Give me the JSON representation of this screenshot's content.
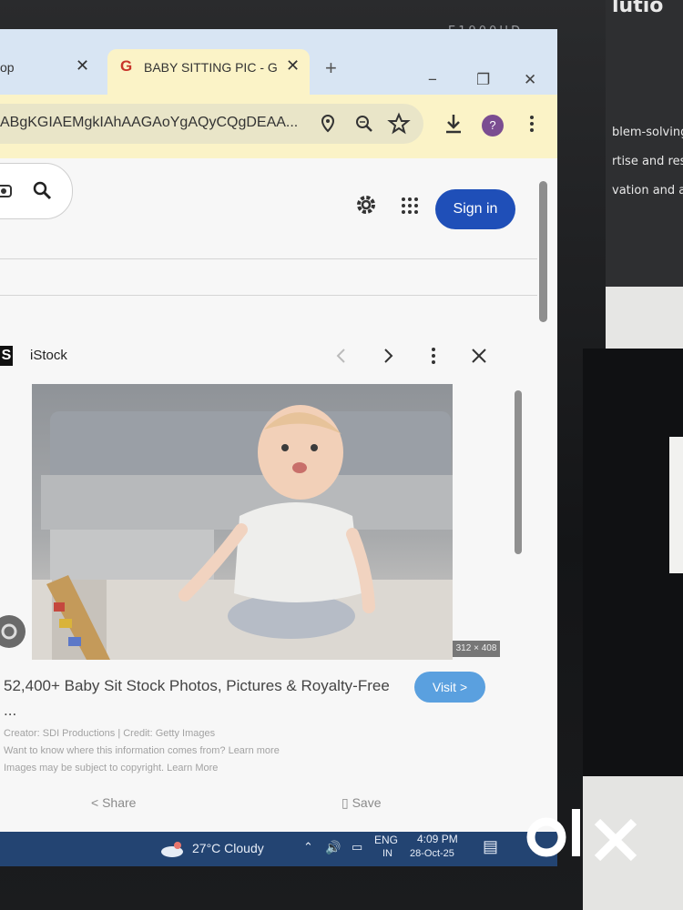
{
  "monitor": {
    "brand": "E1900HD"
  },
  "side_panel": {
    "lines": [
      "lutio",
      "blem-solving",
      "rtise and res",
      "vation and ac"
    ]
  },
  "watermark": {
    "text": "olx"
  },
  "browser": {
    "tabs": [
      {
        "label": "op",
        "close": "✕"
      },
      {
        "label": "BABY SITTING PIC - G",
        "close": "✕",
        "favicon": "G"
      }
    ],
    "new_tab": "+",
    "url": "ABgKGIAEMgkIAhAAGAoYgAQyCQgDEAA...",
    "window_controls": [
      "−",
      "❐",
      "✕"
    ],
    "profile_initial": "?"
  },
  "header": {
    "sign_in": "Sign in"
  },
  "panel": {
    "source": "iStock",
    "source_badge": "S",
    "image_dims": "312 × 408",
    "title": "52,400+ Baby Sit Stock Photos, Pictures & Royalty-Free ...",
    "visit": "Visit >",
    "creator": "Creator: SDI Productions | Credit: Getty Images",
    "info_line": "Want to know where this information comes from? Learn more",
    "copyright_line": "Images may be subject to copyright. Learn More",
    "share": "Share",
    "save": "Save"
  },
  "taskbar": {
    "weather": "27°C  Cloudy",
    "lang": "ENG",
    "lang_region": "IN",
    "time": "4:09 PM",
    "date": "28-Oct-25"
  },
  "colors": {
    "tab_strip": "#d8e5f3",
    "active_tab": "#fbf3c7",
    "sign_in": "#1f4fb8",
    "visit": "#5aa0df",
    "taskbar": "#234472"
  }
}
